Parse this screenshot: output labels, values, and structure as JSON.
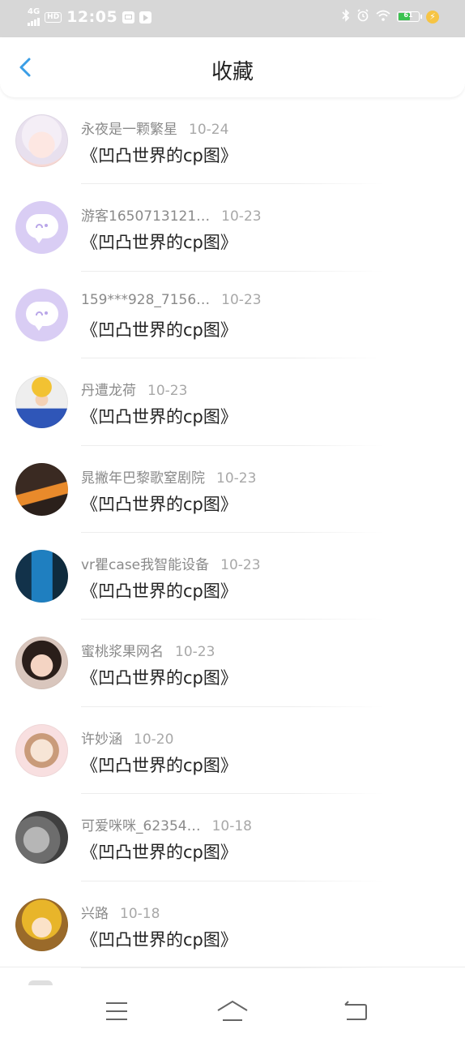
{
  "status_bar": {
    "network": "4G",
    "hd": "HD",
    "time": "12:05",
    "battery": "61",
    "battery_level": 0.61
  },
  "header": {
    "title": "收藏"
  },
  "items": [
    {
      "user": "永夜是一颗繁星",
      "date": "10-24",
      "title": "《凹凸世界的cp图》",
      "avatar": "anime-girl-white-hair"
    },
    {
      "user": "游客1650713121…",
      "date": "10-23",
      "title": "《凹凸世界的cp图》",
      "avatar": "default-chat-bubble"
    },
    {
      "user": "159***928_7156…",
      "date": "10-23",
      "title": "《凹凸世界的cp图》",
      "avatar": "default-chat-bubble"
    },
    {
      "user": "丹遭龙荷",
      "date": "10-23",
      "title": "《凹凸世界的cp图》",
      "avatar": "girl-yellow-hat"
    },
    {
      "user": "晁撇年巴黎歌窒剧院",
      "date": "10-23",
      "title": "《凹凸世界的cp图》",
      "avatar": "girl-dark-orange-banner"
    },
    {
      "user": "vr瞿case我智能设备",
      "date": "10-23",
      "title": "《凹凸世界的cp图》",
      "avatar": "blue-door-scene"
    },
    {
      "user": "蜜桃浆果网名",
      "date": "10-23",
      "title": "《凹凸世界的cp图》",
      "avatar": "girl-portrait"
    },
    {
      "user": "许妙涵",
      "date": "10-20",
      "title": "《凹凸世界的cp图》",
      "avatar": "anime-chibi-pink"
    },
    {
      "user": "可爱咪咪_62354…",
      "date": "10-18",
      "title": "《凹凸世界的cp图》",
      "avatar": "grey-cat"
    },
    {
      "user": "兴路",
      "date": "10-18",
      "title": "《凹凸世界的cp图》",
      "avatar": "anime-blond-character"
    }
  ],
  "colors": {
    "accent": "#3a9ee6",
    "status_bar_bg": "#d7d7d7",
    "default_avatar_bg": "#d9cdf4"
  },
  "system_nav": {
    "menu_icon": "menu-icon",
    "home_icon": "home-icon",
    "back_icon": "back-icon"
  }
}
